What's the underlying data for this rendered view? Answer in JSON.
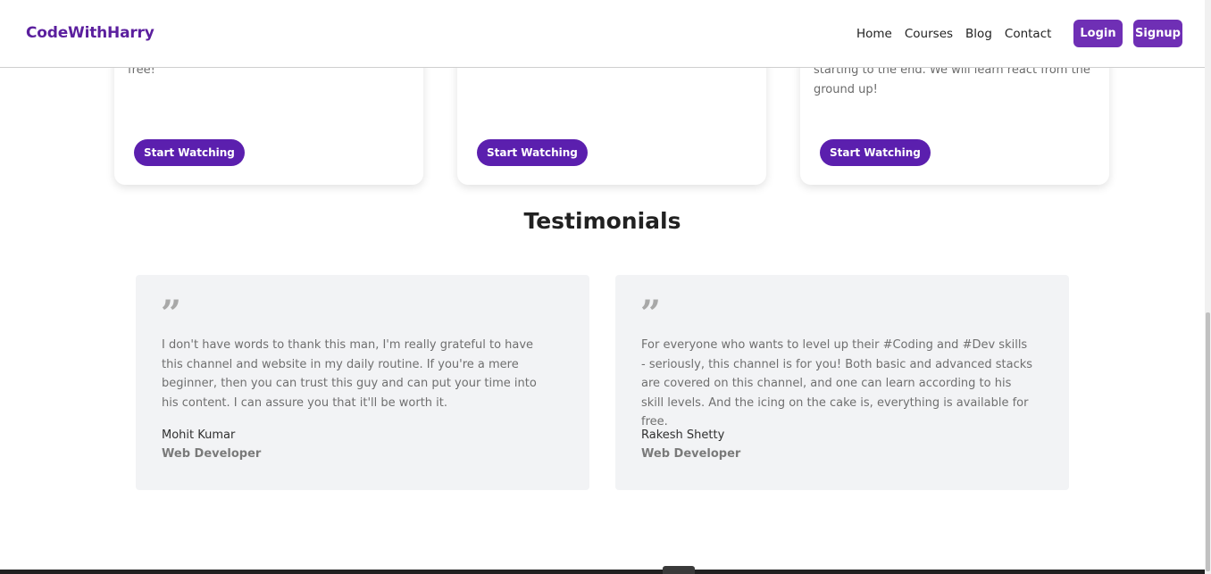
{
  "navbar": {
    "brand": "CodeWithHarry",
    "links": [
      "Home",
      "Courses",
      "Blog",
      "Contact"
    ],
    "login_label": "Login",
    "signup_label": "Signup"
  },
  "courses": [
    {
      "text": "free!",
      "button_label": "Start Watching"
    },
    {
      "text": "",
      "button_label": "Start Watching"
    },
    {
      "text": "starting to the end. We will learn react from the ground up!",
      "button_label": "Start Watching"
    }
  ],
  "testimonials": {
    "title": "Testimonials",
    "items": [
      {
        "quote_mark": "”",
        "text": "I don't have words to thank this man, I'm really grateful to have this channel and website in my daily routine. If you're a mere beginner, then you can trust this guy and can put your time into his content. I can assure you that it'll be worth it.",
        "name": "Mohit Kumar",
        "role": "Web Developer"
      },
      {
        "quote_mark": "”",
        "text": "For everyone who wants to level up their #Coding and #Dev skills - seriously, this channel is for you! Both basic and advanced stacks are covered on this channel, and one can learn according to his skill levels. And the icing on the cake is, everything is available for free.",
        "name": "Rakesh Shetty",
        "role": "Web Developer"
      }
    ]
  },
  "colors": {
    "brand": "#5b1f9e",
    "accent": "#6f2fb5",
    "button": "#5b1fae",
    "card_bg": "#f2f3f5"
  },
  "icons": {
    "quote": "quote-icon"
  }
}
